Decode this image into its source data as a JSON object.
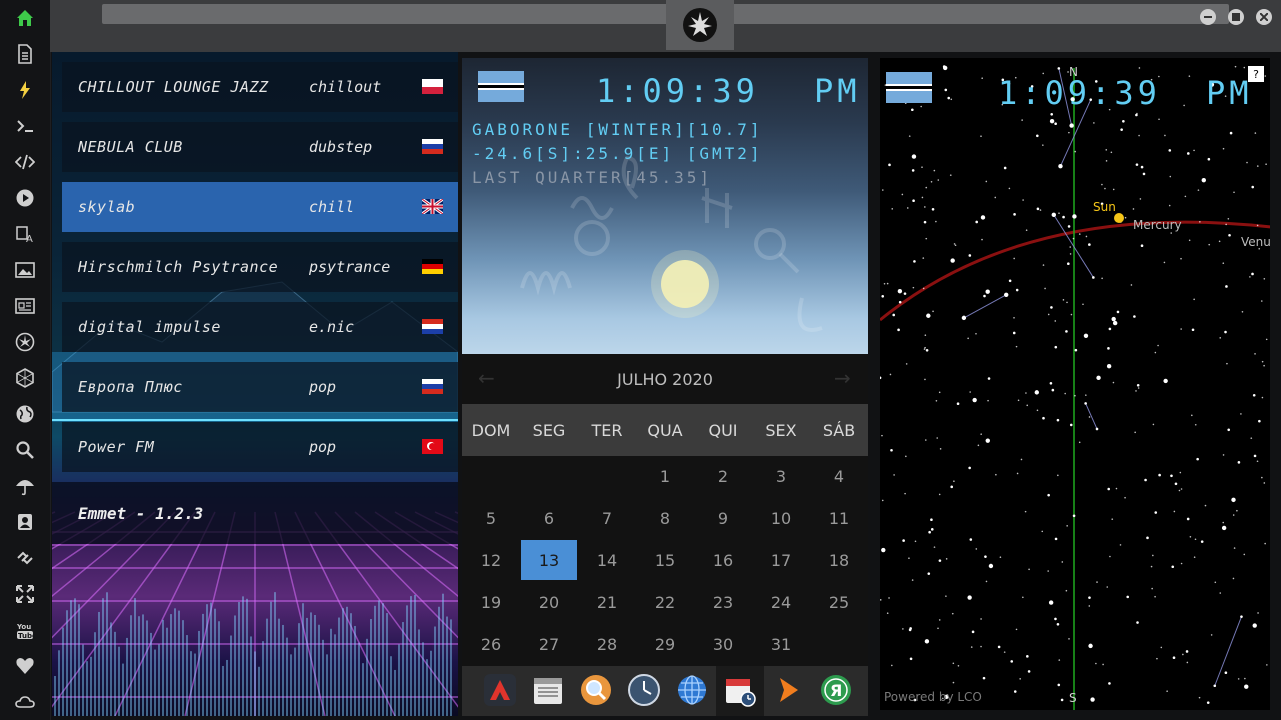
{
  "window": {
    "logo_icon": "rebel-alliance-icon"
  },
  "sidebar": {
    "items": [
      {
        "name": "home-icon",
        "active": true
      },
      {
        "name": "document-icon"
      },
      {
        "name": "lightning-icon"
      },
      {
        "name": "terminal-icon"
      },
      {
        "name": "code-icon"
      },
      {
        "name": "play-icon"
      },
      {
        "name": "translate-icon"
      },
      {
        "name": "image-icon"
      },
      {
        "name": "news-icon"
      },
      {
        "name": "rebel-icon"
      },
      {
        "name": "hexagon-icon"
      },
      {
        "name": "globe-icon"
      },
      {
        "name": "search-icon"
      },
      {
        "name": "umbrella-icon"
      },
      {
        "name": "contacts-icon"
      },
      {
        "name": "link-icon"
      },
      {
        "name": "expand-icon"
      },
      {
        "name": "youtube-icon"
      },
      {
        "name": "heart-icon"
      },
      {
        "name": "cloud-icon"
      }
    ]
  },
  "radio": {
    "stations": [
      {
        "name": "CHILLOUT LOUNGE JAZZ",
        "genre": "chillout",
        "flag": "poland"
      },
      {
        "name": "NEBULA CLUB",
        "genre": "dubstep",
        "flag": "russia"
      },
      {
        "name": "skylab",
        "genre": "chill",
        "flag": "uk",
        "active": true
      },
      {
        "name": "Hirschmilch Psytrance",
        "genre": "psytrance",
        "flag": "germany"
      },
      {
        "name": "digital impulse",
        "genre": "e.nic",
        "flag": "croatia"
      },
      {
        "name": "Европа Плюс",
        "genre": "pop",
        "flag": "russia"
      },
      {
        "name": "Power FM",
        "genre": "pop",
        "flag": "turkey"
      }
    ],
    "footer": "Emmet - 1.2.3"
  },
  "weather": {
    "time": "1:09:39",
    "ampm": "PM",
    "location": "GABORONE [WINTER][10.7]",
    "coords": "-24.6[S]:25.9[E] [GMT2]",
    "moon": "LAST QUARTER[45.35]",
    "flag": "botswana"
  },
  "calendar": {
    "month": "JULHO 2020",
    "weekdays": [
      "DOM",
      "SEG",
      "TER",
      "QUA",
      "QUI",
      "SEX",
      "SÁB"
    ],
    "weeks": [
      [
        "",
        "",
        "",
        "1",
        "2",
        "3",
        "4"
      ],
      [
        "5",
        "6",
        "7",
        "8",
        "9",
        "10",
        "11"
      ],
      [
        "12",
        "13",
        "14",
        "15",
        "16",
        "17",
        "18"
      ],
      [
        "19",
        "20",
        "21",
        "22",
        "23",
        "24",
        "25"
      ],
      [
        "26",
        "27",
        "28",
        "29",
        "30",
        "31",
        ""
      ]
    ],
    "today": "13"
  },
  "dock": [
    "app-launcher-icon",
    "calendar-app-icon",
    "search-icon",
    "clock-icon",
    "globe-icon",
    "calendar-clock-icon",
    "arrow-icon",
    "yandex-icon"
  ],
  "starmap": {
    "time": "1:09:39",
    "ampm": "PM",
    "north": "N",
    "south": "S",
    "help": "?",
    "labels": {
      "sun": "Sun",
      "mercury": "Mercury",
      "venus": "Venu"
    },
    "credit": "Powered by LCO",
    "colors": {
      "meridian": "#1faa1f",
      "ecliptic": "#8a1010",
      "sun": "#f5c518",
      "stars": "#ffffff",
      "lines": "#8a8fd6"
    }
  }
}
